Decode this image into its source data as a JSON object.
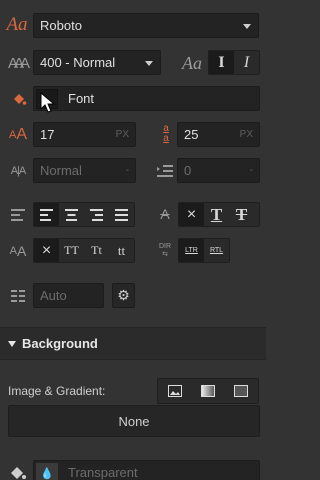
{
  "font": {
    "family_value": "Roboto",
    "weight_value": "400 - Normal",
    "color_label": "Font",
    "size_value": "17",
    "size_unit": "PX",
    "line_height_value": "25",
    "line_height_unit": "PX",
    "letter_spacing_value": "Normal",
    "letter_spacing_unit": "-",
    "indent_value": "0",
    "indent_unit": "-",
    "columns_value": "Auto"
  },
  "style_buttons": {
    "italic_off": "I",
    "italic_on": "I"
  },
  "decoration_buttons": {
    "none": "×",
    "underline": "T",
    "strike": "T"
  },
  "case_buttons": {
    "none": "×",
    "upper": "TT",
    "capitalize": "Tt",
    "lower": "tt"
  },
  "direction_buttons": {
    "ltr": "LTR",
    "rtl": "RTL",
    "label": "DIR"
  },
  "font_icon_text": "Aa",
  "background": {
    "section_title": "Background",
    "image_gradient_label": "Image & Gradient:",
    "image_value": "None",
    "color_value": "Transparent"
  },
  "colors": {
    "accent": "#d9683f",
    "panel": "#333333",
    "field": "#232323"
  }
}
